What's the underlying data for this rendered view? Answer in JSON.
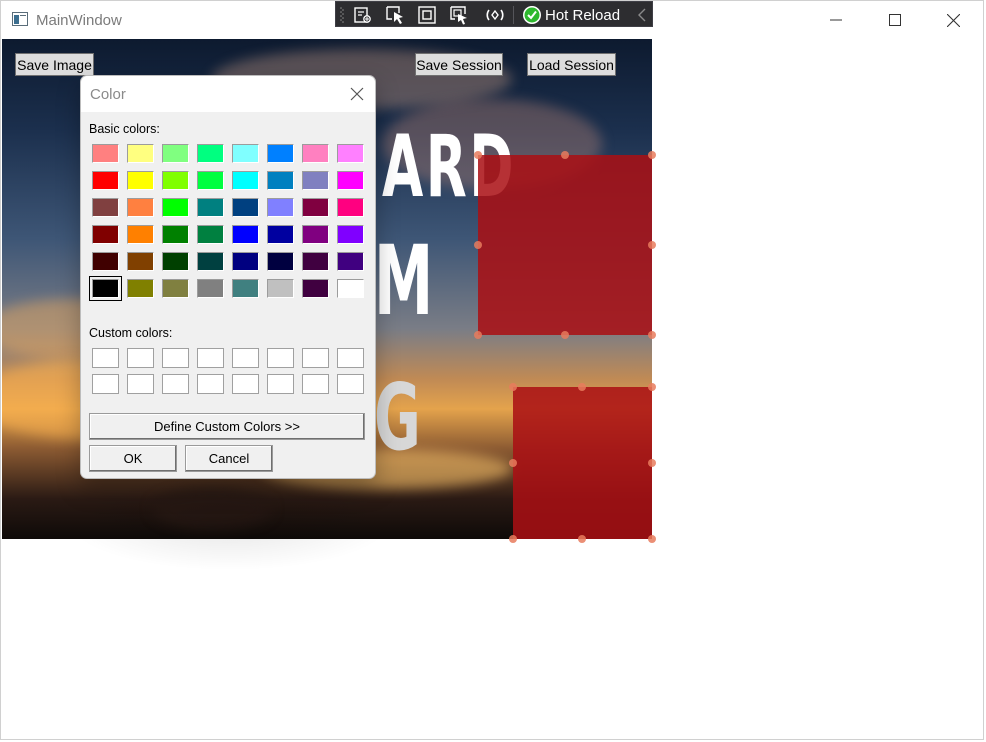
{
  "window": {
    "title": "MainWindow"
  },
  "debug_toolbar": {
    "hot_reload_label": "Hot Reload"
  },
  "main": {
    "save_image_label": "Save Image",
    "save_session_label": "Save Session",
    "load_session_label": "Load Session"
  },
  "poster": {
    "line1": "ARD",
    "line2": "M",
    "line3": "G"
  },
  "color_dialog": {
    "title": "Color",
    "basic_colors_label": "Basic colors:",
    "custom_colors_label": "Custom colors:",
    "define_custom_label": "Define Custom Colors >>",
    "ok_label": "OK",
    "cancel_label": "Cancel",
    "selected_color": "#000000",
    "basic_colors": [
      "#FF8080",
      "#FFFF80",
      "#80FF80",
      "#00FF80",
      "#80FFFF",
      "#0080FF",
      "#FF80C0",
      "#FF80FF",
      "#FF0000",
      "#FFFF00",
      "#80FF00",
      "#00FF40",
      "#00FFFF",
      "#0080C0",
      "#8080C0",
      "#FF00FF",
      "#804040",
      "#FF8040",
      "#00FF00",
      "#008080",
      "#004080",
      "#8080FF",
      "#800040",
      "#FF0080",
      "#800000",
      "#FF8000",
      "#008000",
      "#008040",
      "#0000FF",
      "#0000A0",
      "#800080",
      "#8000FF",
      "#400000",
      "#804000",
      "#004000",
      "#004040",
      "#000080",
      "#000040",
      "#400040",
      "#400080",
      "#000000",
      "#808000",
      "#808040",
      "#808080",
      "#408080",
      "#C0C0C0",
      "#400040",
      "#FFFFFF"
    ],
    "custom_colors": [
      "#FFFFFF",
      "#FFFFFF",
      "#FFFFFF",
      "#FFFFFF",
      "#FFFFFF",
      "#FFFFFF",
      "#FFFFFF",
      "#FFFFFF",
      "#FFFFFF",
      "#FFFFFF",
      "#FFFFFF",
      "#FFFFFF",
      "#FFFFFF",
      "#FFFFFF",
      "#FFFFFF",
      "#FFFFFF"
    ]
  },
  "colors": {
    "shape_fill": "#AA0F14",
    "handle": "#E77B5D",
    "hot_reload_check": "#2EB82E"
  }
}
